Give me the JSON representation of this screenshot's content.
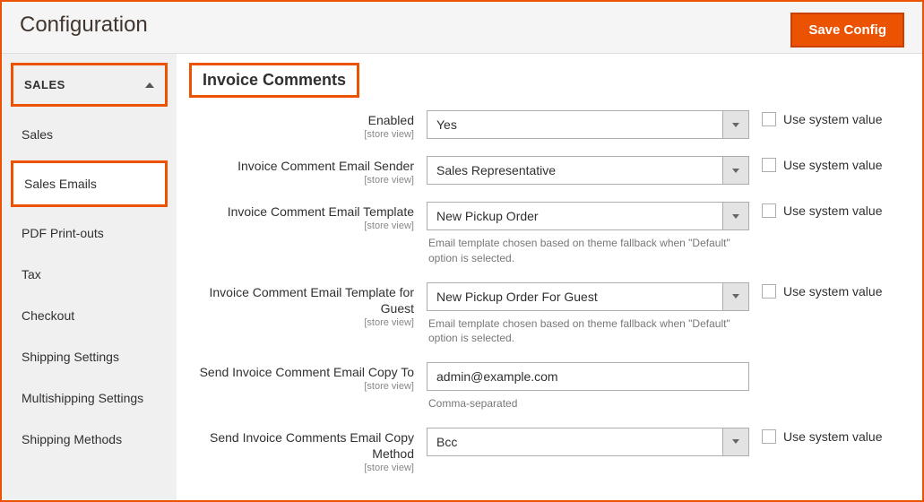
{
  "page_title": "Configuration",
  "save_button": "Save Config",
  "sidebar": {
    "group": "SALES",
    "items": [
      "Sales",
      "Sales Emails",
      "PDF Print-outs",
      "Tax",
      "Checkout",
      "Shipping Settings",
      "Multishipping Settings",
      "Shipping Methods"
    ]
  },
  "section_title": "Invoice Comments",
  "scope": "[store view]",
  "use_system": "Use system value",
  "fields": {
    "enabled": {
      "label": "Enabled",
      "value": "Yes"
    },
    "sender": {
      "label": "Invoice Comment Email Sender",
      "value": "Sales Representative"
    },
    "template": {
      "label": "Invoice Comment Email Template",
      "value": "New Pickup Order",
      "hint": "Email template chosen based on theme fallback when \"Default\" option is selected."
    },
    "template_guest": {
      "label": "Invoice Comment Email Template for Guest",
      "value": "New Pickup Order For Guest",
      "hint": "Email template chosen based on theme fallback when \"Default\" option is selected."
    },
    "copy_to": {
      "label": "Send Invoice Comment Email Copy To",
      "value": "admin@example.com",
      "hint": "Comma-separated"
    },
    "copy_method": {
      "label": "Send Invoice Comments Email Copy Method",
      "value": "Bcc"
    }
  }
}
